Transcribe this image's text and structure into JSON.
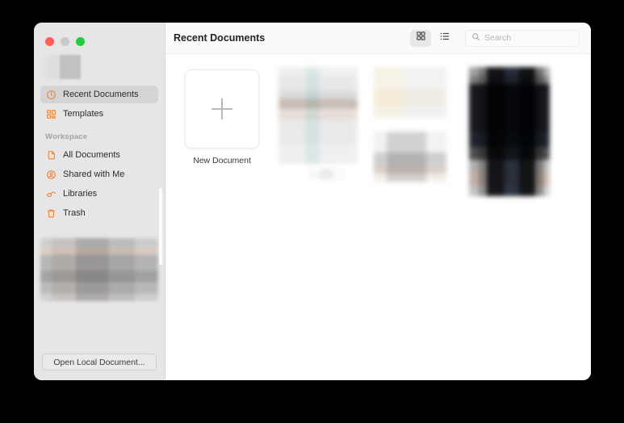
{
  "window": {
    "traffic_lights": [
      {
        "name": "close",
        "color": "#ff5f57"
      },
      {
        "name": "minimize",
        "color": "#c9c9c9"
      },
      {
        "name": "maximize",
        "color": "#28c840"
      }
    ]
  },
  "sidebar": {
    "accent_color": "#f07c2b",
    "background": "#e6e6e6",
    "primary_items": [
      {
        "label": "Recent Documents",
        "icon": "clock-icon",
        "selected": true
      },
      {
        "label": "Templates",
        "icon": "templates-grid-icon",
        "selected": false
      }
    ],
    "group_title": "Workspace",
    "workspace_items": [
      {
        "label": "All Documents",
        "icon": "documents-icon",
        "selected": false
      },
      {
        "label": "Shared with Me",
        "icon": "person-circle-icon",
        "selected": false
      },
      {
        "label": "Libraries",
        "icon": "books-icon",
        "selected": false
      },
      {
        "label": "Trash",
        "icon": "trash-icon",
        "selected": false
      }
    ],
    "footer_button": "Open Local Document..."
  },
  "toolbar": {
    "title": "Recent Documents",
    "grid_view_label": "Grid view",
    "list_view_label": "List view",
    "active_view": "grid"
  },
  "search": {
    "placeholder": "Search",
    "value": "",
    "icon": "search-icon"
  },
  "content": {
    "new_document_label": "New Document",
    "new_document_icon": "plus-icon",
    "documents": [
      {
        "name": "document-thumbnail-1",
        "redacted": true
      },
      {
        "name": "document-thumbnail-2",
        "redacted": true
      },
      {
        "name": "document-thumbnail-3",
        "redacted": true
      }
    ]
  }
}
